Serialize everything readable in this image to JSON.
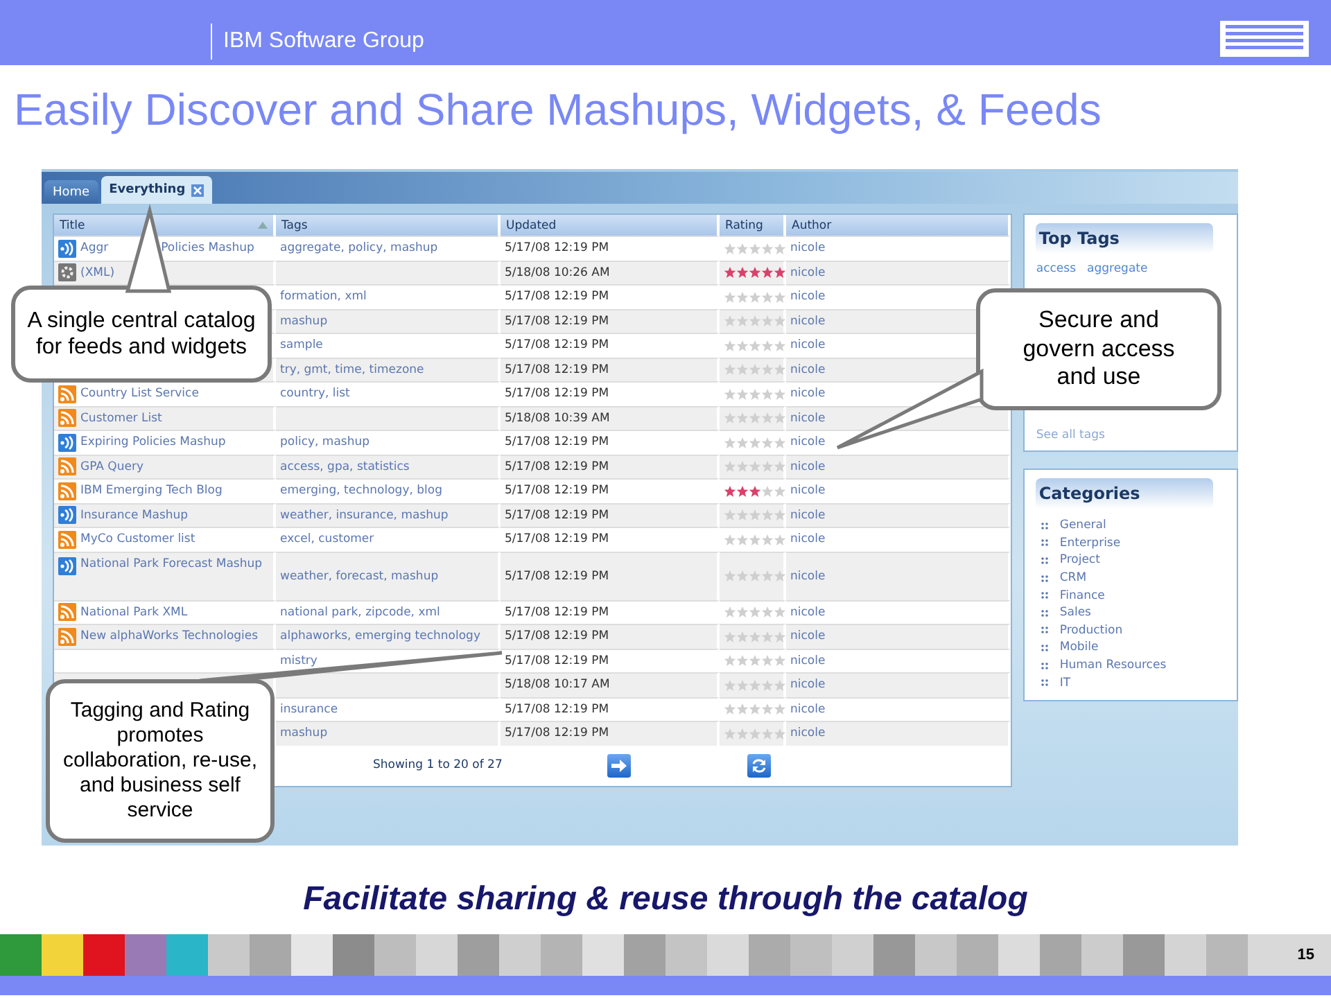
{
  "header": {
    "group": "IBM Software Group"
  },
  "title": "Easily Discover and Share Mashups, Widgets, & Feeds",
  "app": {
    "tabs": [
      {
        "label": "Home",
        "selected": false
      },
      {
        "label": "Everything",
        "selected": true
      }
    ],
    "table": {
      "columns": [
        "Title",
        "Tags",
        "Updated",
        "Rating",
        "Author"
      ],
      "rows": [
        {
          "kind": "mashup",
          "title_parts": [
            "Aggr",
            "Policies Mashup"
          ],
          "tags": "aggregate, policy, mashup",
          "updated": "5/17/08 12:19 PM",
          "stars": 0,
          "author": "nicole"
        },
        {
          "kind": "widget",
          "title": "(XML)",
          "updated": "5/18/08 10:26 AM",
          "stars": 5,
          "author": "nicole"
        },
        {
          "tags": "formation, xml",
          "updated": "5/17/08 12:19 PM",
          "stars": 0,
          "author": "nicole"
        },
        {
          "tags": "mashup",
          "updated": "5/17/08 12:19 PM",
          "stars": 0,
          "author": "nicole"
        },
        {
          "tags": "sample",
          "updated": "5/17/08 12:19 PM",
          "stars": 0,
          "author": "nicole"
        },
        {
          "tags": "try, gmt, time, timezone",
          "updated": "5/17/08 12:19 PM",
          "stars": 0,
          "author": "nicole"
        },
        {
          "kind": "rss",
          "title": "Country List Service",
          "tags": "country, list",
          "updated": "5/17/08 12:19 PM",
          "stars": 0,
          "author": "nicole"
        },
        {
          "kind": "rss",
          "title": "Customer List",
          "updated": "5/18/08 10:39 AM",
          "stars": 0,
          "author": "nicole"
        },
        {
          "kind": "mashup",
          "title": "Expiring Policies Mashup",
          "tags": "policy, mashup",
          "updated": "5/17/08 12:19 PM",
          "stars": 0,
          "author": "nicole"
        },
        {
          "kind": "rss",
          "title": "GPA Query",
          "tags": "access, gpa, statistics",
          "updated": "5/17/08 12:19 PM",
          "stars": 0,
          "author": "nicole"
        },
        {
          "kind": "rss",
          "title": "IBM Emerging Tech Blog",
          "tags": "emerging, technology, blog",
          "updated": "5/17/08 12:19 PM",
          "stars": 3,
          "author": "nicole"
        },
        {
          "kind": "mashup",
          "title": "Insurance Mashup",
          "tags": "weather, insurance, mashup",
          "updated": "5/17/08 12:19 PM",
          "stars": 0,
          "author": "nicole"
        },
        {
          "kind": "rss",
          "title": "MyCo Customer list",
          "tags": "excel, customer",
          "updated": "5/17/08 12:19 PM",
          "stars": 0,
          "author": "nicole"
        },
        {
          "kind": "mashup",
          "title": "National Park Forecast Mashup",
          "tags": "weather, forecast, mashup",
          "updated": "5/17/08 12:19 PM",
          "stars": 0,
          "author": "nicole"
        },
        {
          "kind": "rss",
          "title": "National Park XML",
          "tags": "national park, zipcode, xml",
          "updated": "5/17/08 12:19 PM",
          "stars": 0,
          "author": "nicole"
        },
        {
          "kind": "rss",
          "title": "New alphaWorks Technologies",
          "tags": "alphaworks, emerging technology",
          "updated": "5/17/08 12:19 PM",
          "stars": 0,
          "author": "nicole"
        },
        {
          "tags": "mistry",
          "updated": "5/17/08 12:19 PM",
          "stars": 0,
          "author": "nicole"
        },
        {
          "updated": "5/18/08 10:17 AM",
          "stars": 0,
          "author": "nicole"
        },
        {
          "tags": "insurance",
          "updated": "5/17/08 12:19 PM",
          "stars": 0,
          "author": "nicole"
        },
        {
          "tags": "mashup",
          "updated": "5/17/08 12:19 PM",
          "stars": 0,
          "author": "nicole"
        }
      ]
    },
    "pager": "Showing 1 to 20 of 27",
    "top_tags": {
      "heading": "Top Tags",
      "tags": [
        "access",
        "aggregate"
      ],
      "link": "See all tags"
    },
    "categories": {
      "heading": "Categories",
      "items": [
        "General",
        "Enterprise",
        "Project",
        "CRM",
        "Finance",
        "Sales",
        "Production",
        "Mobile",
        "Human Resources",
        "IT"
      ]
    }
  },
  "callouts": [
    "A single central catalog for feeds and widgets",
    "Secure and govern access and use",
    "Tagging and Rating promotes collaboration, re-use, and business self service"
  ],
  "caption": "Facilitate sharing & reuse through the catalog",
  "page_number": "15"
}
